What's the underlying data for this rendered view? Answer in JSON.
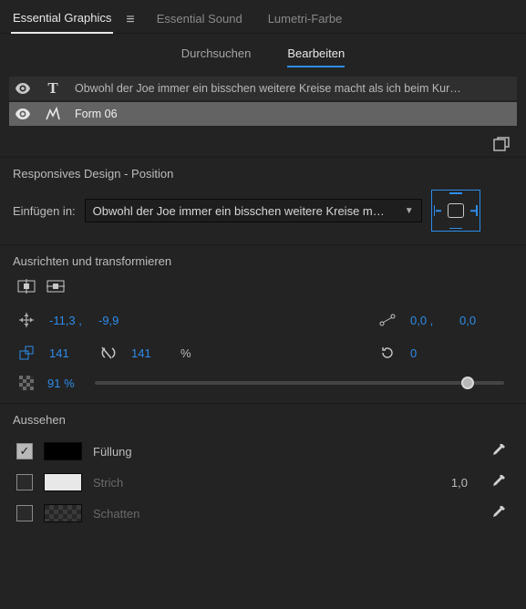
{
  "panel_tabs": {
    "essential_graphics": "Essential Graphics",
    "essential_sound": "Essential Sound",
    "lumetri": "Lumetri-Farbe"
  },
  "sub_tabs": {
    "browse": "Durchsuchen",
    "edit": "Bearbeiten"
  },
  "layers": [
    {
      "label": "Obwohl der Joe immer ein bisschen weitere Kreise macht als ich beim Kur…",
      "type": "text",
      "selected": false
    },
    {
      "label": "Form 06",
      "type": "shape",
      "selected": true
    }
  ],
  "responsive": {
    "title": "Responsives Design - Position",
    "pin_label": "Einfügen in:",
    "dropdown_value": "Obwohl der Joe immer ein bisschen weitere Kreise m…"
  },
  "align": {
    "title": "Ausrichten und transformieren",
    "position_x": "-11,3 ,",
    "position_y": "-9,9",
    "anchor_x": "0,0 ,",
    "anchor_y": "0,0",
    "scale_w": "141",
    "scale_h": "141",
    "scale_unit": "%",
    "rotation": "0",
    "opacity": "91 %"
  },
  "appearance": {
    "title": "Aussehen",
    "fill_label": "Füllung",
    "stroke_label": "Strich",
    "stroke_value": "1,0",
    "shadow_label": "Schatten"
  }
}
